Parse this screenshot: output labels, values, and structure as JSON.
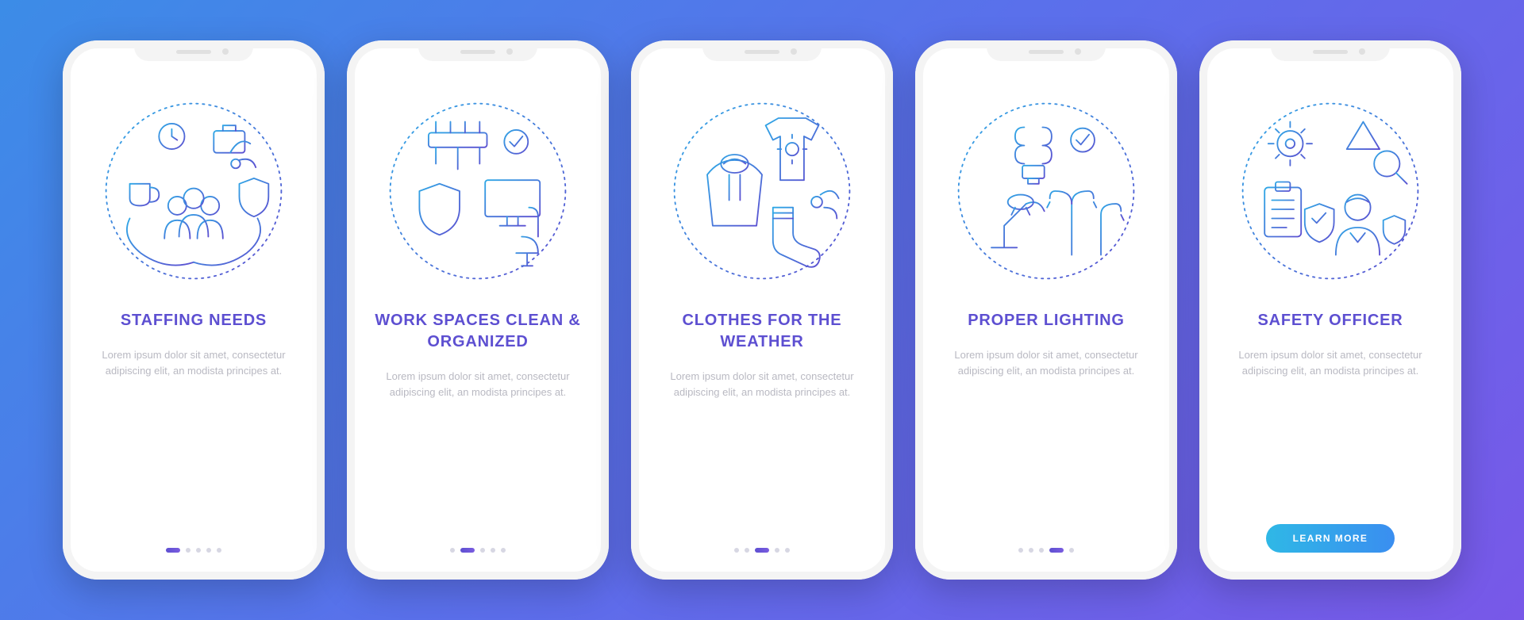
{
  "common": {
    "body_text": "Lorem ipsum dolor sit amet, consectetur adipiscing elit, an modista principes at.",
    "cta_label": "LEARN MORE",
    "total_slides": 5
  },
  "slides": [
    {
      "title": "STAFFING NEEDS",
      "icon": "staffing-needs-icon",
      "active_index": 0
    },
    {
      "title": "WORK SPACES CLEAN & ORGANIZED",
      "icon": "workspaces-clean-icon",
      "active_index": 1
    },
    {
      "title": "CLOTHES FOR THE WEATHER",
      "icon": "clothes-weather-icon",
      "active_index": 2
    },
    {
      "title": "PROPER LIGHTING",
      "icon": "proper-lighting-icon",
      "active_index": 3
    },
    {
      "title": "SAFETY OFFICER",
      "icon": "safety-officer-icon",
      "active_index": 4
    }
  ]
}
